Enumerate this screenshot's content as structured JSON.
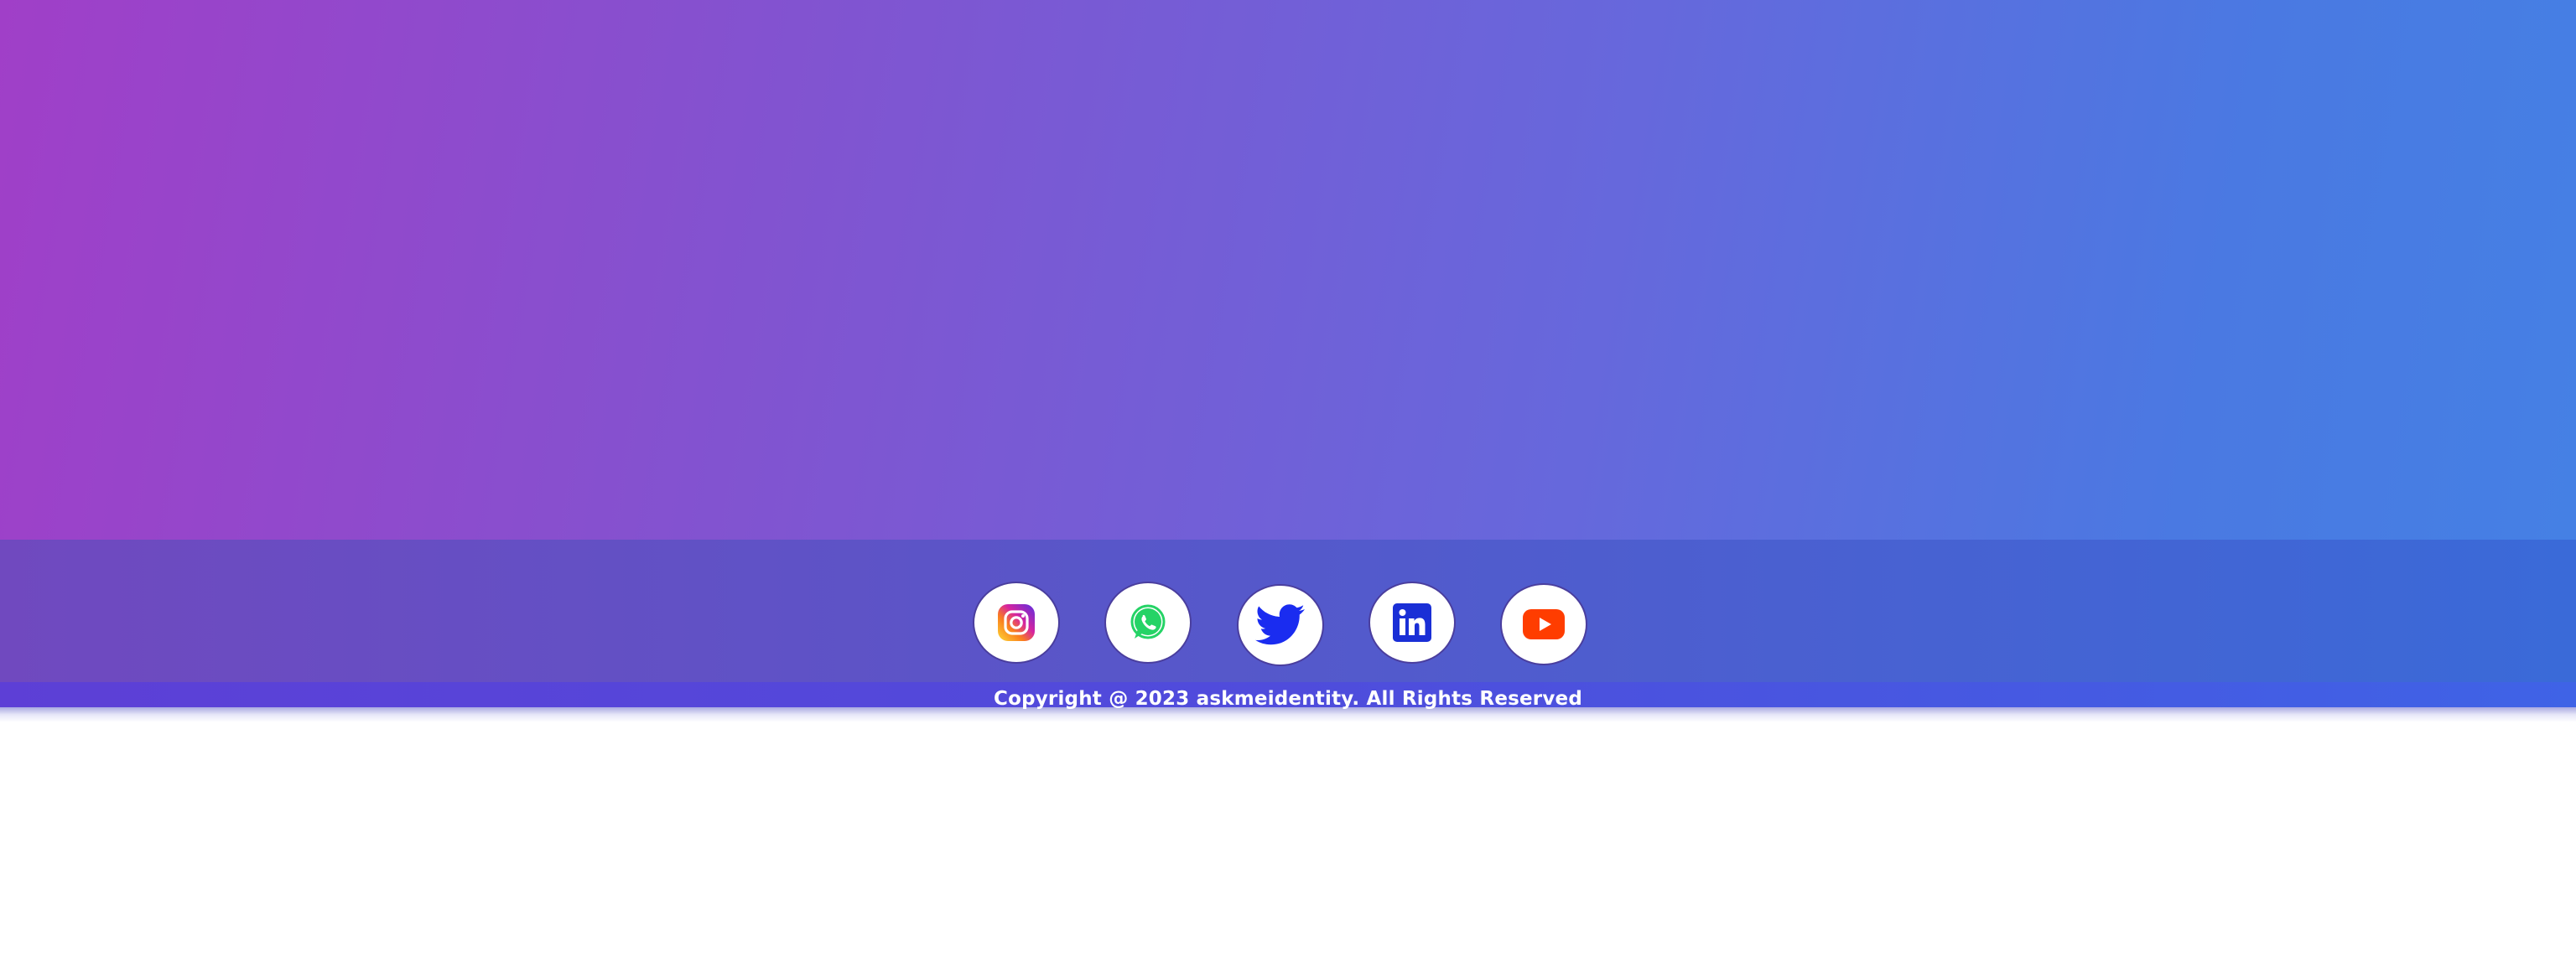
{
  "footer": {
    "social_links": [
      {
        "name": "Instagram",
        "icon": "instagram-icon",
        "color": "#d6249f"
      },
      {
        "name": "WhatsApp",
        "icon": "whatsapp-icon",
        "color": "#25d366"
      },
      {
        "name": "Twitter",
        "icon": "twitter-icon",
        "color": "#1a2cf0"
      },
      {
        "name": "LinkedIn",
        "icon": "linkedin-icon",
        "color": "#1a2fd6"
      },
      {
        "name": "YouTube",
        "icon": "youtube-icon",
        "color": "#ff3d00"
      }
    ],
    "copyright": "Copyright @ 2023 askmeidentity. All Rights Reserved"
  },
  "colors": {
    "hero_gradient_start": "#a03fc8",
    "hero_gradient_end": "#4580e4",
    "social_band": "#5a55c8",
    "copyright_band": "#4f4cdc"
  }
}
